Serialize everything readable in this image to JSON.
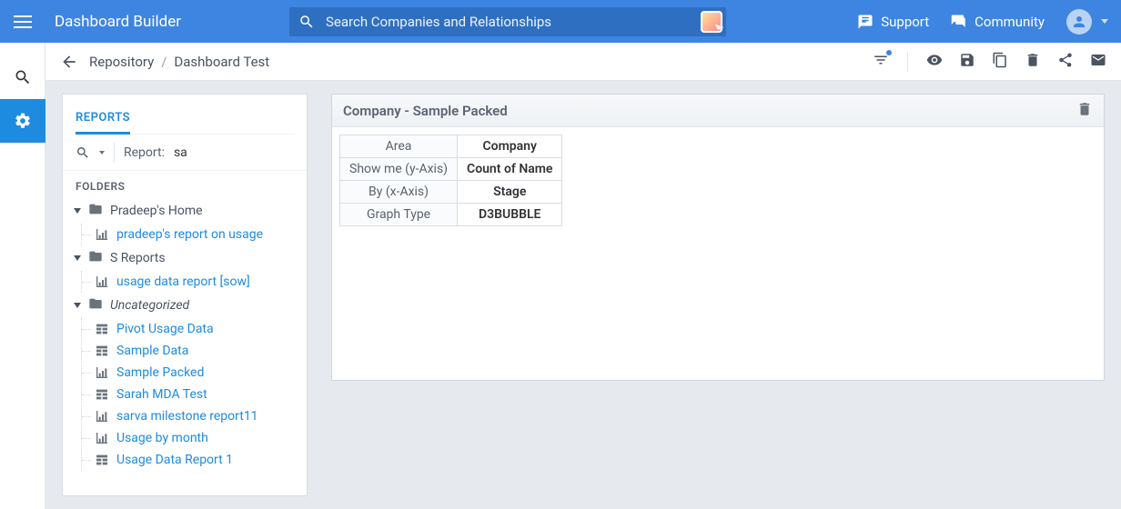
{
  "app": {
    "title": "Dashboard Builder"
  },
  "search": {
    "placeholder": "Search Companies and Relationships"
  },
  "top_nav": {
    "support": "Support",
    "community": "Community"
  },
  "breadcrumb": {
    "root": "Repository",
    "current": "Dashboard Test",
    "separator": "/"
  },
  "reports_panel": {
    "tab_label": "REPORTS",
    "search_prefix": "Report:",
    "search_value": "sa",
    "folders_header": "FOLDERS"
  },
  "tree": {
    "folders": [
      {
        "name": "Pradeep's Home",
        "italic": false,
        "items": [
          {
            "icon": "chart",
            "label": "pradeep's report on usage"
          }
        ]
      },
      {
        "name": "S Reports",
        "italic": false,
        "items": [
          {
            "icon": "chart",
            "label": "usage data report [sow]"
          }
        ]
      },
      {
        "name": "Uncategorized",
        "italic": true,
        "items": [
          {
            "icon": "table",
            "label": "Pivot Usage Data"
          },
          {
            "icon": "table",
            "label": "Sample Data"
          },
          {
            "icon": "chart",
            "label": "Sample Packed"
          },
          {
            "icon": "table",
            "label": "Sarah MDA Test"
          },
          {
            "icon": "chart",
            "label": "sarva milestone report11"
          },
          {
            "icon": "chart",
            "label": "Usage by month"
          },
          {
            "icon": "table",
            "label": "Usage Data Report 1"
          }
        ]
      }
    ]
  },
  "widget": {
    "title": "Company - Sample Packed",
    "rows": [
      {
        "key": "Area",
        "value": "Company"
      },
      {
        "key": "Show me (y-Axis)",
        "value": "Count of Name"
      },
      {
        "key": "By (x-Axis)",
        "value": "Stage"
      },
      {
        "key": "Graph Type",
        "value": "D3BUBBLE"
      }
    ]
  }
}
